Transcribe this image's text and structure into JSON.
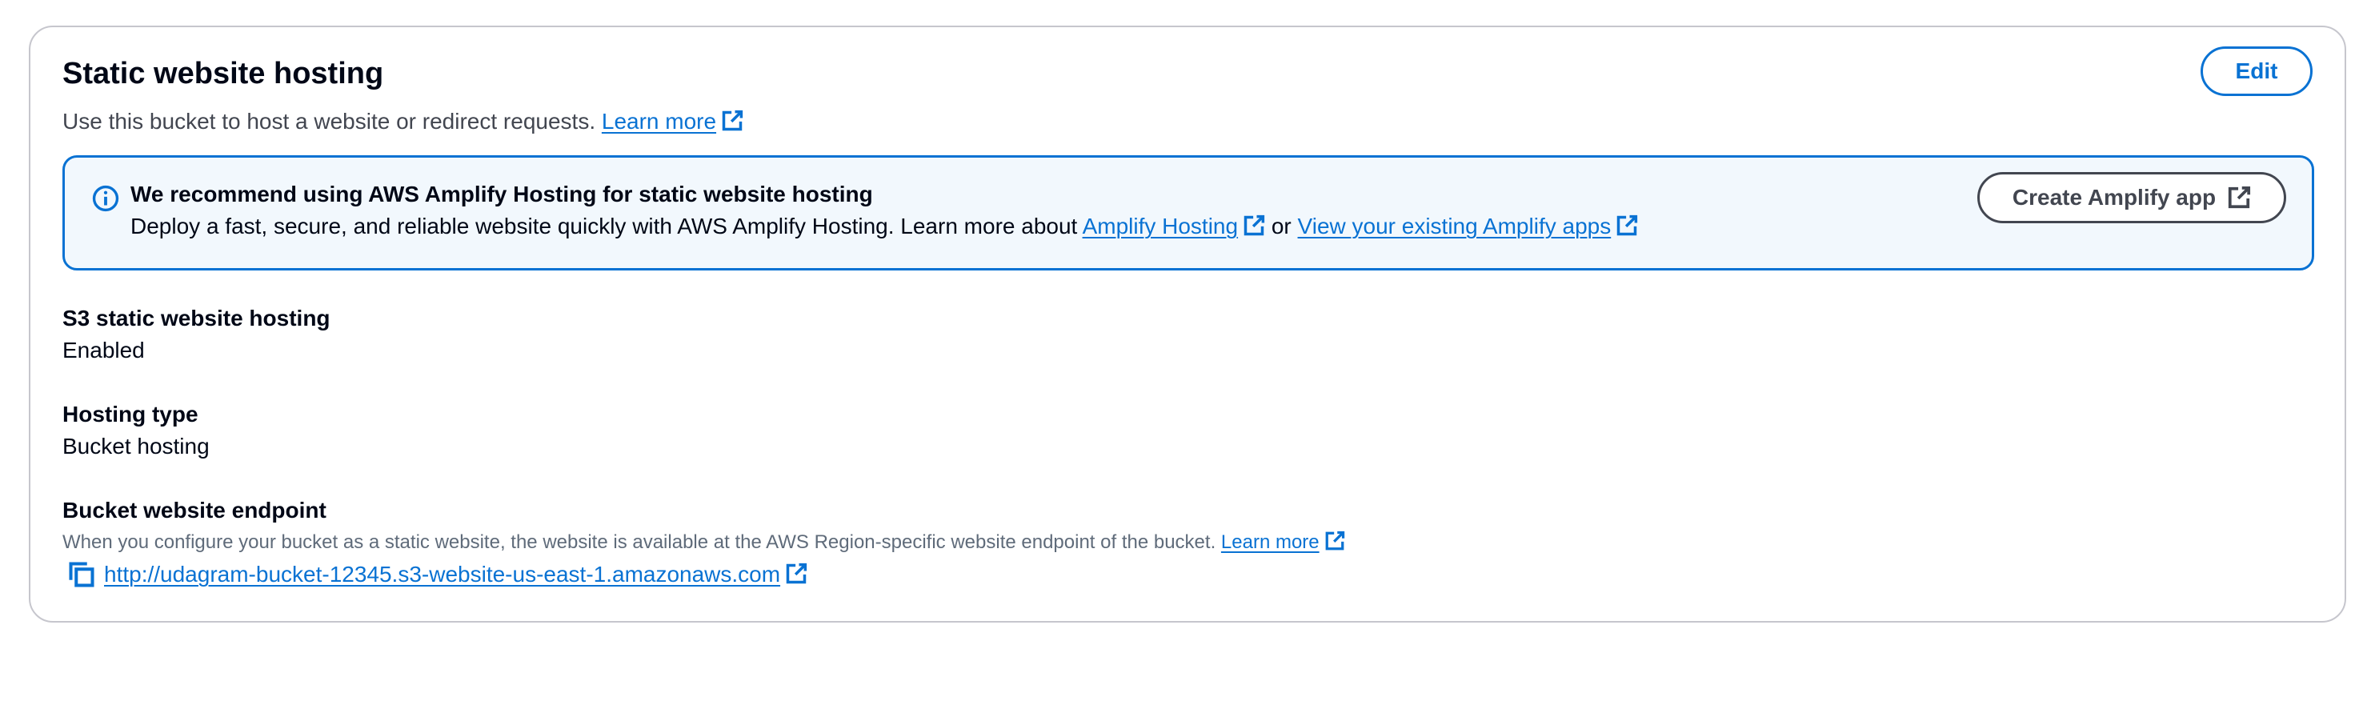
{
  "panel": {
    "title": "Static website hosting",
    "description": "Use this bucket to host a website or redirect requests.",
    "learn_more_label": "Learn more",
    "edit_label": "Edit"
  },
  "alert": {
    "heading": "We recommend using AWS Amplify Hosting for static website hosting",
    "body_text": "Deploy a fast, secure, and reliable website quickly with AWS Amplify Hosting. Learn more about",
    "amplify_hosting_link": "Amplify Hosting",
    "or_text": "or",
    "existing_apps_link": "View your existing Amplify apps",
    "create_button_label": "Create Amplify app"
  },
  "details": {
    "s3_hosting": {
      "label": "S3 static website hosting",
      "value": "Enabled"
    },
    "hosting_type": {
      "label": "Hosting type",
      "value": "Bucket hosting"
    },
    "endpoint": {
      "label": "Bucket website endpoint",
      "description": "When you configure your bucket as a static website, the website is available at the AWS Region-specific website endpoint of the bucket.",
      "learn_more_label": "Learn more",
      "url": "http://udagram-bucket-12345.s3-website-us-east-1.amazonaws.com"
    }
  },
  "icons": {
    "external": "external-link-icon",
    "info": "info-icon",
    "copy": "copy-icon"
  },
  "colors": {
    "link": "#0972d3",
    "alert_bg": "#f2f8fd",
    "alert_border": "#0972d3",
    "panel_border": "#c6c6cd",
    "text": "#000716",
    "secondary_text": "#5f6b7a"
  }
}
